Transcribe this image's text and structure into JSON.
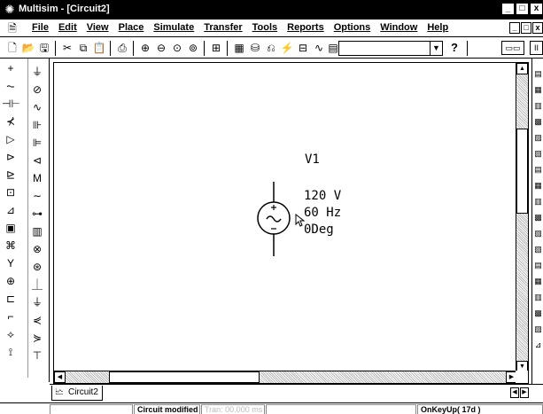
{
  "window": {
    "title": "Multisim - [Circuit2]",
    "controls": {
      "minimize": "_",
      "maximize": "□",
      "close": "x"
    }
  },
  "menu": {
    "items": [
      "File",
      "Edit",
      "View",
      "Place",
      "Simulate",
      "Transfer",
      "Tools",
      "Reports",
      "Options",
      "Window",
      "Help"
    ],
    "mdi_controls": {
      "minimize": "_",
      "restore": "□",
      "close": "x"
    }
  },
  "toolbar": {
    "combo_value": "",
    "help_label": "?",
    "icons": [
      "new-icon",
      "open-icon",
      "save-icon",
      "cut-icon",
      "copy-icon",
      "paste-icon",
      "print-icon",
      "zoom-in-icon",
      "zoom-out-icon",
      "zoom-area-icon",
      "zoom-fit-icon",
      "hierarchy-icon",
      "spreadsheet-icon",
      "database-icon",
      "wizard-icon",
      "electrical-rules-icon",
      "postprocessor-icon",
      "grapher-icon",
      "component-list-icon"
    ]
  },
  "component": {
    "refdes": "V1",
    "voltage": "120 V",
    "frequency": "60 Hz",
    "phase": "0Deg"
  },
  "tabs": [
    {
      "label": "Circuit2"
    }
  ],
  "status": {
    "message": "Circuit modified",
    "simulation": "Tran: 00.000 ms",
    "event": "OnKeyUp( 17d )"
  }
}
